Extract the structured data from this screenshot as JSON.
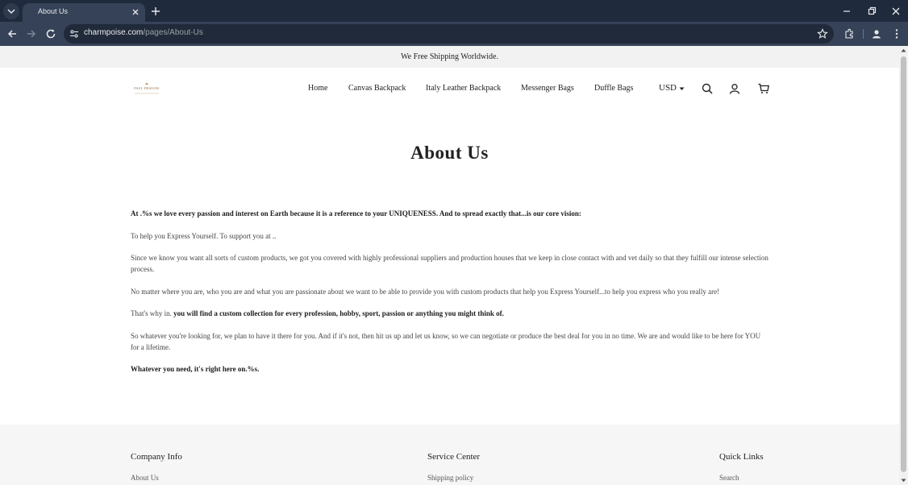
{
  "browser": {
    "tab_title": "About Us",
    "url_domain": "charmpoise.com",
    "url_path": "/pages/About-Us"
  },
  "site": {
    "announcement": "We Free Shipping Worldwide.",
    "logo_text": "PAUL DESIGNS",
    "nav": {
      "home": "Home",
      "canvas": "Canvas Backpack",
      "italy": "Italy Leather Backpack",
      "messenger": "Messenger Bags",
      "duffle": "Duffle Bags"
    },
    "currency": "USD"
  },
  "page": {
    "title": "About Us",
    "p1": "At .%s we love every passion and interest on Earth because it is a reference to your UNIQUENESS. And to spread exactly that...is our core vision:",
    "p2": "To help you Express Yourself.  To support you at ..",
    "p3": "Since we know you want all sorts of custom products, we got you covered with highly professional suppliers and production houses that we keep in close contact with and vet daily so that they fulfill our intense selection process.",
    "p4": "No matter where you are, who you are and what you are passionate about we want to be able to provide you with custom products that help you Express Yourself...to help you express who you really are!",
    "p5_lead": "That's why in. ",
    "p5_strong": "you will find a custom collection for every profession, hobby, sport, passion or anything you might think of.",
    "p6": "So whatever you're looking for, we plan to have it there for you. And if it's not, then hit us up and let us know, so we can negotiate or produce the best deal for you in no time. We are and would like to be here for YOU for a lifetime.",
    "p7": "Whatever you need, it's right here on.%s."
  },
  "footer": {
    "col1_title": "Company Info",
    "col1_link": "About Us",
    "col2_title": "Service Center",
    "col2_link": "Shipping policy",
    "col3_title": "Quick Links",
    "col3_link": "Search"
  }
}
